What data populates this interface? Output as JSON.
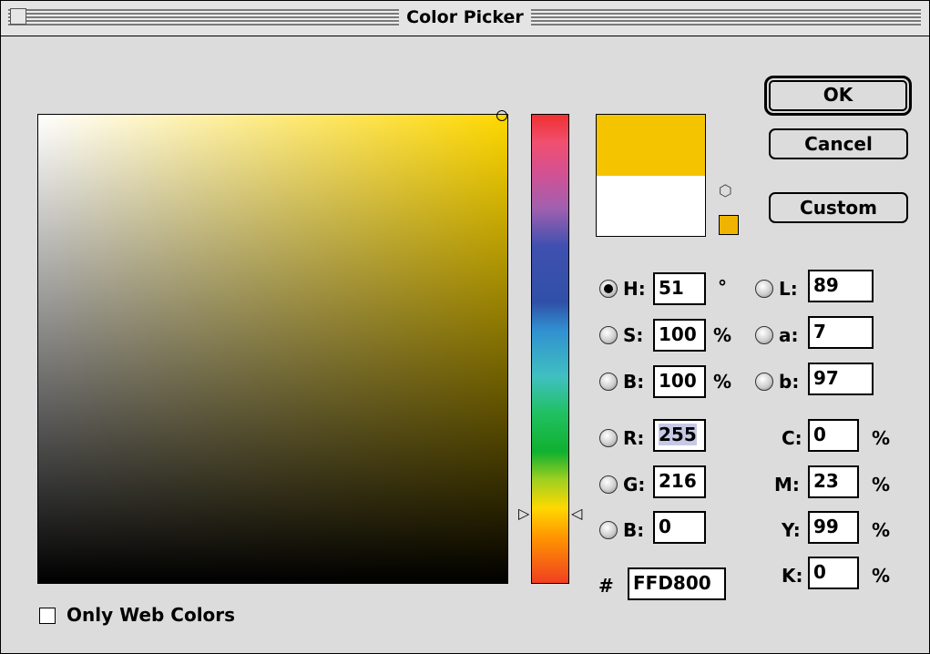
{
  "window": {
    "title": "Color Picker"
  },
  "buttons": {
    "ok": "OK",
    "cancel": "Cancel",
    "custom": "Custom"
  },
  "colors": {
    "new": "#f5c400",
    "old": "#ffffff",
    "pure_hue": "#ffd800"
  },
  "hsb": {
    "h": {
      "label": "H:",
      "value": "51",
      "unit": "°",
      "selected": true
    },
    "s": {
      "label": "S:",
      "value": "100",
      "unit": "%"
    },
    "b": {
      "label": "B:",
      "value": "100",
      "unit": "%"
    }
  },
  "lab": {
    "l": {
      "label": "L:",
      "value": "89"
    },
    "a": {
      "label": "a:",
      "value": "7"
    },
    "b": {
      "label": "b:",
      "value": "97"
    }
  },
  "rgb": {
    "r": {
      "label": "R:",
      "value": "255"
    },
    "g": {
      "label": "G:",
      "value": "216"
    },
    "b": {
      "label": "B:",
      "value": "0"
    }
  },
  "cmyk": {
    "c": {
      "label": "C:",
      "value": "0",
      "unit": "%"
    },
    "m": {
      "label": "M:",
      "value": "23",
      "unit": "%"
    },
    "y": {
      "label": "Y:",
      "value": "99",
      "unit": "%"
    },
    "k": {
      "label": "K:",
      "value": "0",
      "unit": "%"
    }
  },
  "hex": {
    "label": "#",
    "value": "FFD800"
  },
  "web_colors": {
    "label": "Only Web Colors",
    "checked": false
  },
  "icons": {
    "gamut_warning": "cube-icon",
    "hue_left": "triangle-right-icon",
    "hue_right": "triangle-left-icon"
  }
}
